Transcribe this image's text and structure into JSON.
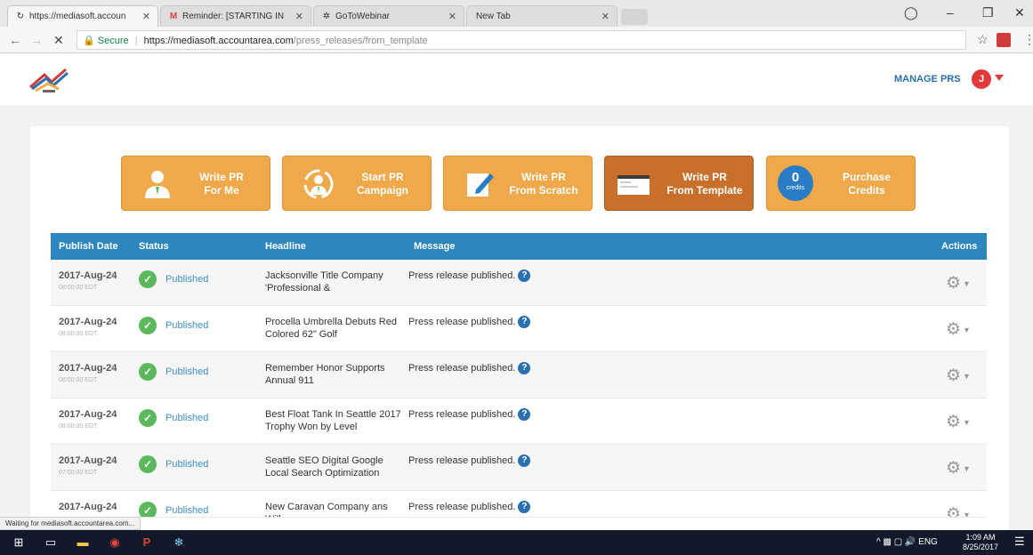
{
  "browser": {
    "tabs": [
      {
        "label": "https://mediasoft.accoun",
        "icon": "reload-icon",
        "active": true
      },
      {
        "label": "Reminder: [STARTING IN",
        "icon": "gmail-icon",
        "active": false
      },
      {
        "label": "GoToWebinar",
        "icon": "webinar-icon",
        "active": false
      },
      {
        "label": "New Tab",
        "icon": "none",
        "active": false
      }
    ],
    "secure_label": "Secure",
    "url_host": "https://mediasoft.accountarea.com",
    "url_path": "/press_releases/from_template",
    "status_text": "Waiting for mediasoft.accountarea.com..."
  },
  "header": {
    "manage_label": "MANAGE PRS",
    "avatar_letter": "J"
  },
  "actions": [
    {
      "line1": "Write PR",
      "line2": "For Me"
    },
    {
      "line1": "Start PR",
      "line2": "Campaign"
    },
    {
      "line1": "Write PR",
      "line2": "From Scratch"
    },
    {
      "line1": "Write PR",
      "line2": "From Template"
    },
    {
      "line1": "Purchase",
      "line2": "Credits",
      "credits_count": "0",
      "credits_label": "credits"
    }
  ],
  "table": {
    "columns": {
      "date": "Publish Date",
      "status": "Status",
      "headline": "Headline",
      "message": "Message",
      "actions": "Actions"
    },
    "rows": [
      {
        "date": "2017-Aug-24",
        "time": "08:00:00 EDT",
        "status": "Published",
        "headline": "Jacksonville Title Company 'Professional &",
        "message": "Press release published."
      },
      {
        "date": "2017-Aug-24",
        "time": "08:00:00 EDT",
        "status": "Published",
        "headline": "Procella Umbrella Debuts Red Colored 62\" Golf",
        "message": "Press release published."
      },
      {
        "date": "2017-Aug-24",
        "time": "08:00:00 EDT",
        "status": "Published",
        "headline": "Remember Honor Supports Annual 911",
        "message": "Press release published."
      },
      {
        "date": "2017-Aug-24",
        "time": "08:00:00 EDT",
        "status": "Published",
        "headline": "Best Float Tank In Seattle 2017 Trophy Won by Level",
        "message": "Press release published."
      },
      {
        "date": "2017-Aug-24",
        "time": "07:00:00 EDT",
        "status": "Published",
        "headline": "Seattle SEO Digital Google Local Search Optimization",
        "message": "Press release published."
      },
      {
        "date": "2017-Aug-24",
        "time": "",
        "status": "Published",
        "headline": "New Caravan Company ans Will",
        "message": "Press release published."
      }
    ]
  },
  "taskbar": {
    "tray_lang": "ENG",
    "time": "1:09 AM",
    "date": "8/25/2017"
  },
  "colors": {
    "button_orange": "#f0a94a",
    "button_active": "#c8702b",
    "table_header": "#2d86be",
    "published_green": "#5cb85c",
    "link_blue": "#2a6fb0"
  }
}
